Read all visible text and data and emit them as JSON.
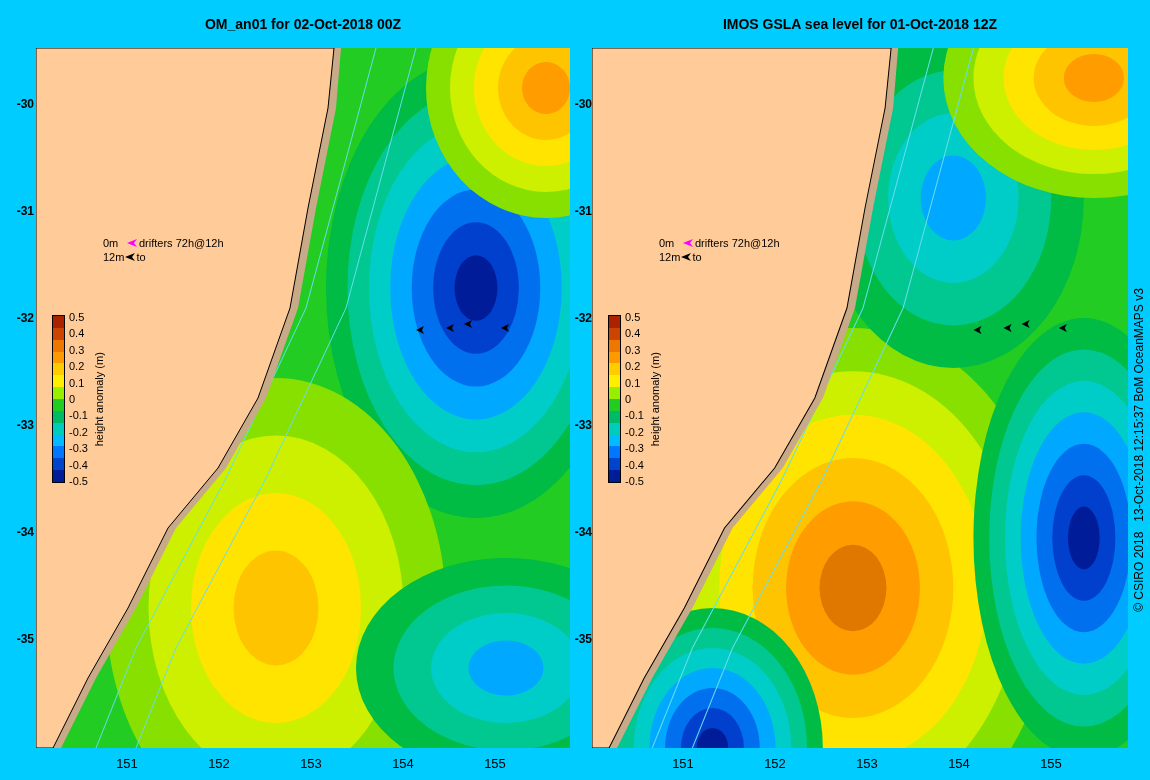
{
  "panels": [
    {
      "kind": "model",
      "title": "OM_an01 for 02-Oct-2018 00Z",
      "legend": {
        "depth_1": "0m",
        "label_1": "drifters 72h@12h",
        "depth_2": "12m",
        "label_2": "to"
      },
      "colorbar": {
        "label": "height anomaly (m)",
        "ticks": [
          "0.5",
          "0.4",
          "0.3",
          "0.2",
          "0.1",
          "0",
          "-0.1",
          "-0.2",
          "-0.3",
          "-0.4",
          "-0.5"
        ]
      },
      "y_ticks": [
        "-30",
        "-31",
        "-32",
        "-33",
        "-34",
        "-35"
      ],
      "x_ticks": [
        "151",
        "152",
        "153",
        "154",
        "155"
      ]
    },
    {
      "kind": "observed",
      "title": "IMOS GSLA sea level  for 01-Oct-2018 12Z",
      "legend": {
        "depth_1": "0m",
        "label_1": "drifters 72h@12h",
        "depth_2": "12m",
        "label_2": "to"
      },
      "colorbar": {
        "label": "height anomaly (m)",
        "ticks": [
          "0.5",
          "0.4",
          "0.3",
          "0.2",
          "0.1",
          "0",
          "-0.1",
          "-0.2",
          "-0.3",
          "-0.4",
          "-0.5"
        ]
      },
      "y_ticks": [
        "-30",
        "-31",
        "-32",
        "-33",
        "-34",
        "-35"
      ],
      "x_ticks": [
        "151",
        "152",
        "153",
        "154",
        "155"
      ]
    }
  ],
  "credit": "© CSIRO 2018   13-Oct-2018 12:15:37 BoM OceanMAPS v3"
}
